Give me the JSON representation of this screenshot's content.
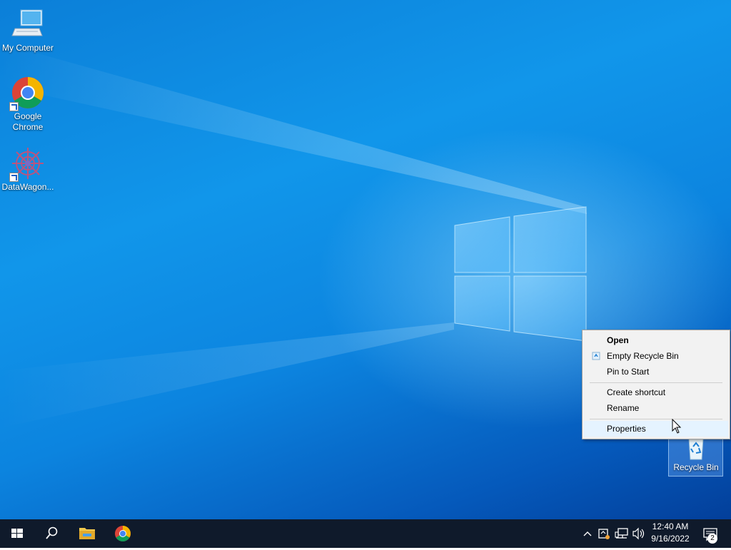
{
  "desktop": {
    "icons": [
      {
        "label": "My Computer",
        "icon": "computer-icon"
      },
      {
        "label": "Google Chrome",
        "icon": "chrome-icon",
        "shortcut": true
      },
      {
        "label": "DataWagon...",
        "icon": "datawagon-icon",
        "shortcut": true
      },
      {
        "label": "Recycle Bin",
        "icon": "recycle-bin-icon",
        "selected": true
      }
    ]
  },
  "context_menu": {
    "items": [
      {
        "label": "Open",
        "bold": true
      },
      {
        "label": "Empty Recycle Bin",
        "icon": "recycle-small-icon"
      },
      {
        "label": "Pin to Start"
      },
      {
        "label": "Create shortcut"
      },
      {
        "label": "Rename"
      },
      {
        "label": "Properties",
        "hovered": true
      }
    ]
  },
  "taskbar": {
    "buttons": [
      "start-icon",
      "search-icon",
      "file-explorer-icon",
      "chrome-icon"
    ],
    "tray_icons": [
      "chevron-up-icon",
      "security-icon",
      "network-icon",
      "volume-icon"
    ],
    "time": "12:40 AM",
    "date": "9/16/2022",
    "notification_count": "2"
  },
  "colors": {
    "taskbar": "#0f1a2b",
    "desktop_accent": "#0b7fd8",
    "menu_bg": "#f2f2f2"
  }
}
